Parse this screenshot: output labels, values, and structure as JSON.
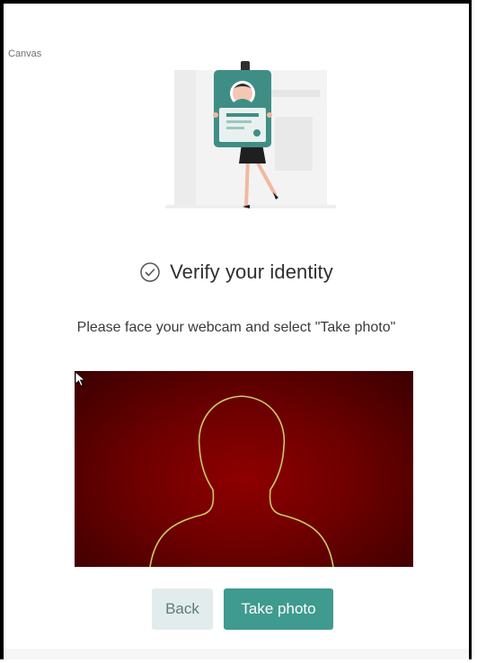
{
  "app": {
    "title": "Canvas"
  },
  "illustration": {
    "icon": "id-badge-illustration"
  },
  "verify": {
    "title": "Verify your identity",
    "icon": "check-circle-icon",
    "instruction": "Please face your webcam and select \"Take photo\""
  },
  "webcam": {
    "overlay": "head-silhouette-guide",
    "background_color": "#7a0000",
    "outline_color": "#c9c96a"
  },
  "buttons": {
    "back_label": "Back",
    "take_photo_label": "Take photo"
  },
  "colors": {
    "accent": "#3f9a8f",
    "secondary_button": "#e3ecec"
  }
}
